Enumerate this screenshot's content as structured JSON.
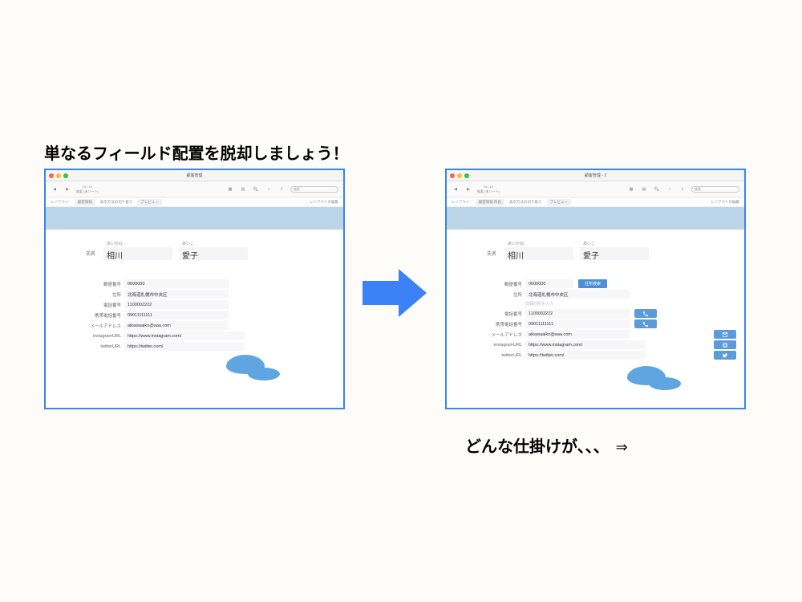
{
  "headline": "単なるフィールド配置を脱却しましょう！",
  "caption": "どんな仕掛けが、、、",
  "caption_arrow": "⇒",
  "left_window": {
    "title": "顧客管理",
    "toolbar": {
      "record_info": "10 / 10",
      "sort_label": "検索 (未ソート)",
      "search_placeholder": "検索"
    },
    "subtoolbar": {
      "layout_label": "レイアウト:",
      "layout_value": "顧客情報",
      "nav": "表示方法の切り替え",
      "preview": "プレビュー",
      "edit_layout": "レイアウトの編集"
    },
    "name_label": "氏名",
    "surname_furigana": "あいかわ",
    "surname": "相川",
    "given_furigana": "あいこ",
    "given": "愛子",
    "fields": [
      {
        "label": "郵便番号",
        "value": "0600000"
      },
      {
        "label": "住所",
        "value": "北海道札幌市中央区"
      },
      {
        "label": "電話番号",
        "value": "1100002222"
      },
      {
        "label": "携帯電話番号",
        "value": "09011111111"
      },
      {
        "label": "メールアドレス",
        "value": "aikawaaiko@aaa.com"
      },
      {
        "label": "instagramURL",
        "value": "https://www.instagram.com/"
      },
      {
        "label": "twitterURL",
        "value": "https://twitter.com/"
      }
    ]
  },
  "right_window": {
    "title": "顧客管理 - 2",
    "toolbar": {
      "record_info": "10 / 10",
      "sort_label": "検索 (未ソート)",
      "search_placeholder": "検索"
    },
    "subtoolbar": {
      "layout_label": "レイアウト:",
      "layout_value": "顧客情報 改良",
      "nav": "表示方法の切り替え",
      "preview": "プレビュー",
      "edit_layout": "レイアウトの編集"
    },
    "name_label": "氏名",
    "surname_furigana": "あいかわ",
    "surname": "相川",
    "given_furigana": "あいこ",
    "given": "愛子",
    "postal": {
      "label": "郵便番号",
      "value": "0600000",
      "button": "住所検索"
    },
    "address": {
      "label": "住所",
      "value": "北海道札幌市中央区"
    },
    "address_extra": "詳細住所を入力",
    "phone": {
      "label": "電話番号",
      "value": "1100002222"
    },
    "mobile": {
      "label": "携帯電話番号",
      "value": "09011111111"
    },
    "email": {
      "label": "メールアドレス",
      "value": "aikawaaiko@aaa.com"
    },
    "instagram": {
      "label": "instagramURL",
      "value": "https://www.instagram.com/"
    },
    "twitter": {
      "label": "twitterURL",
      "value": "https://twitter.com/"
    }
  }
}
